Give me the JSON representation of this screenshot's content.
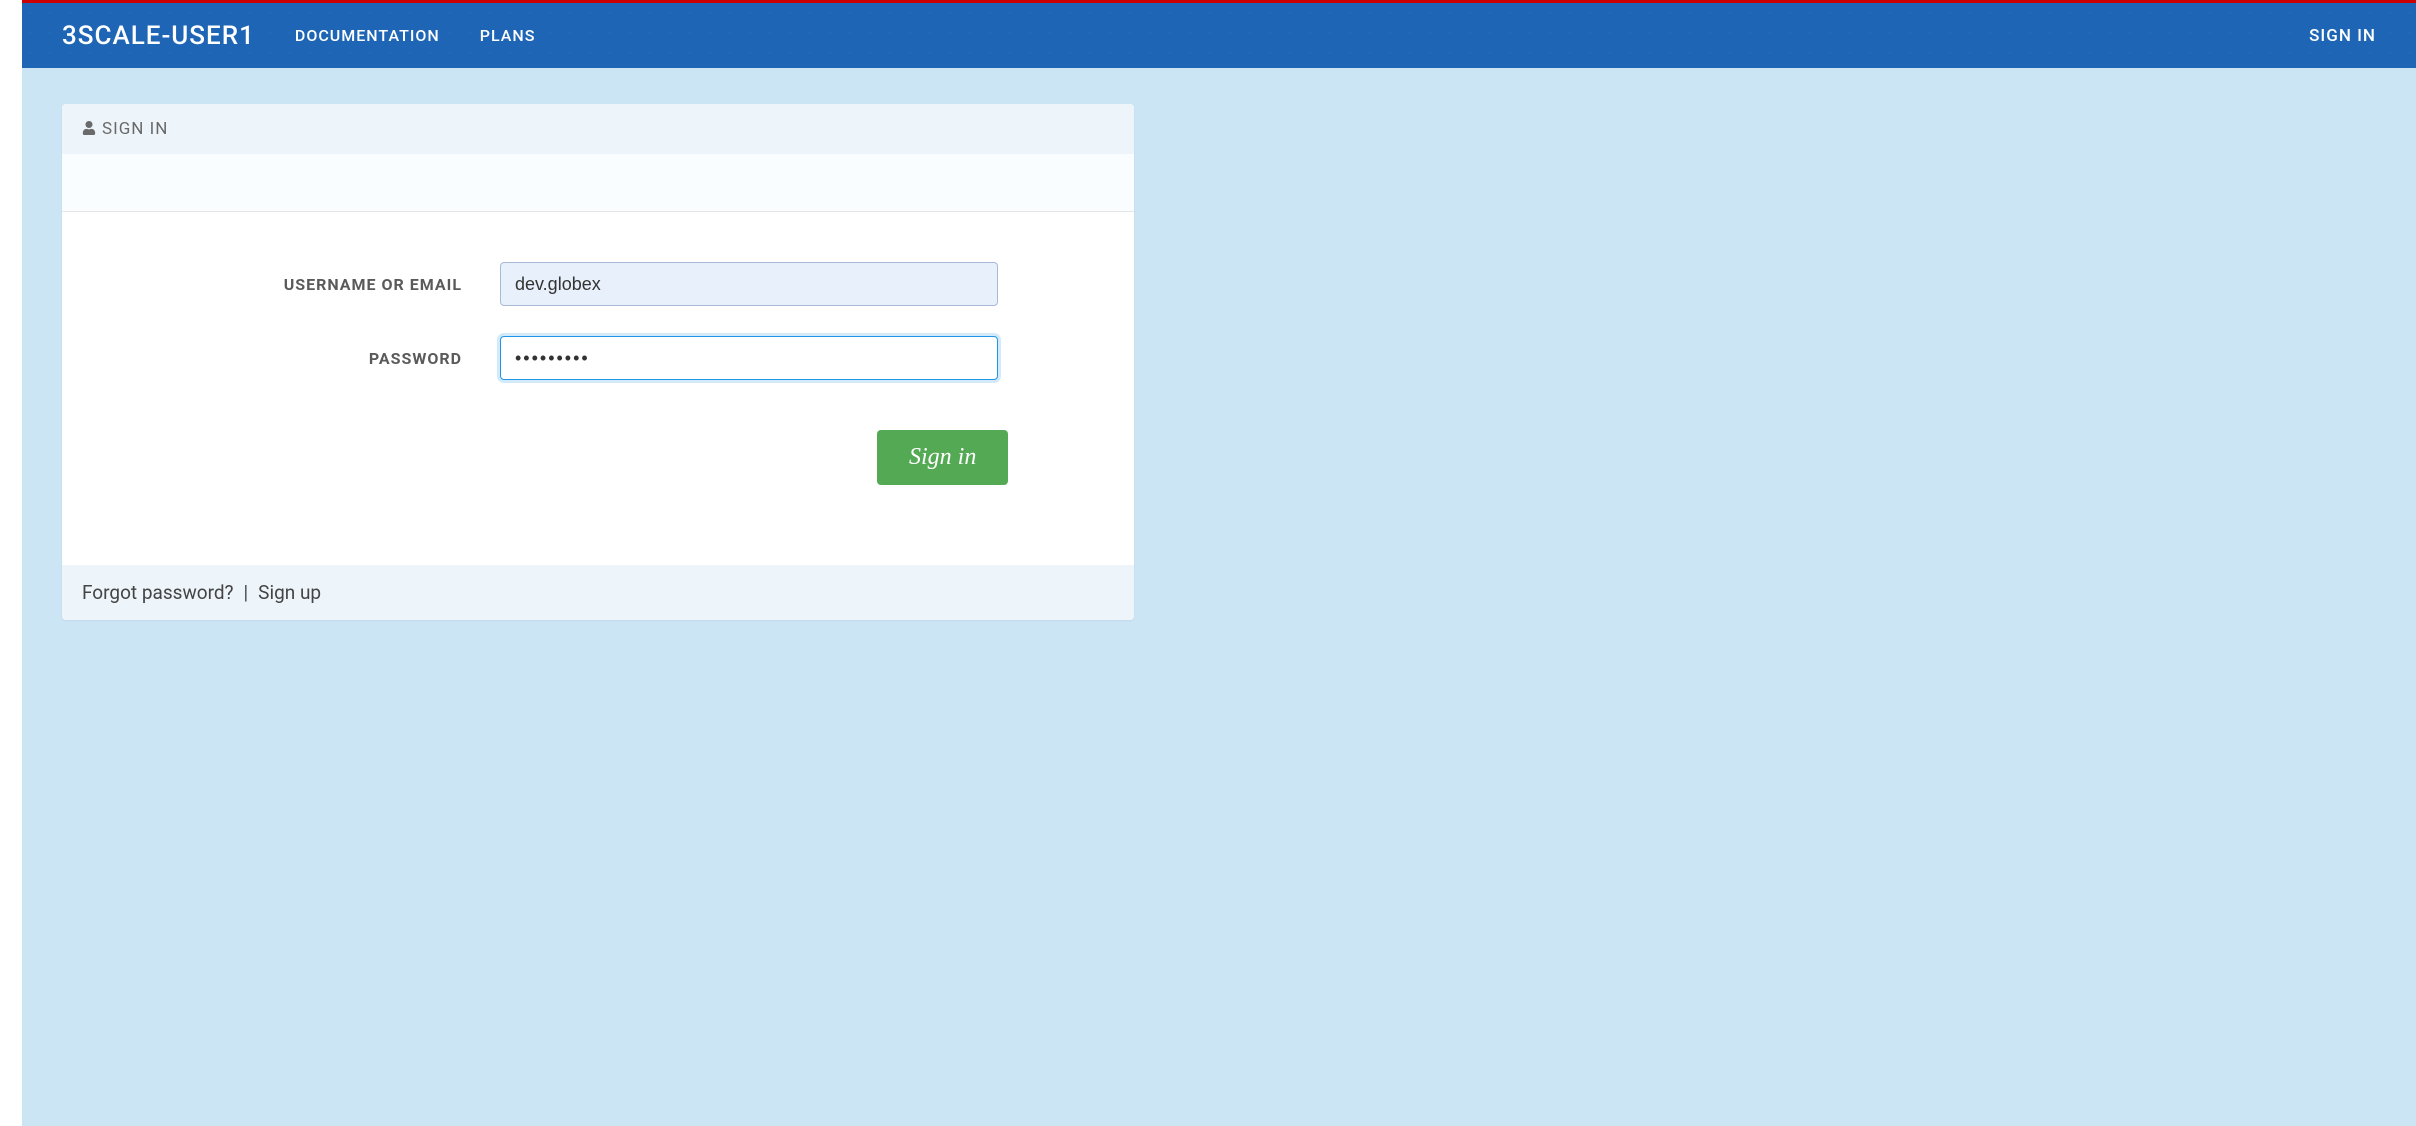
{
  "header": {
    "brand": "3SCALE-USER1",
    "nav": {
      "documentation": "DOCUMENTATION",
      "plans": "PLANS"
    },
    "sign_in": "SIGN IN"
  },
  "panel": {
    "title": "SIGN IN",
    "form": {
      "username_label": "USERNAME OR EMAIL",
      "username_value": "dev.globex",
      "password_label": "PASSWORD",
      "password_value": "•••••••••",
      "submit_label": "Sign in"
    },
    "footer": {
      "forgot_password": "Forgot password?",
      "separator": "|",
      "sign_up": "Sign up"
    }
  }
}
